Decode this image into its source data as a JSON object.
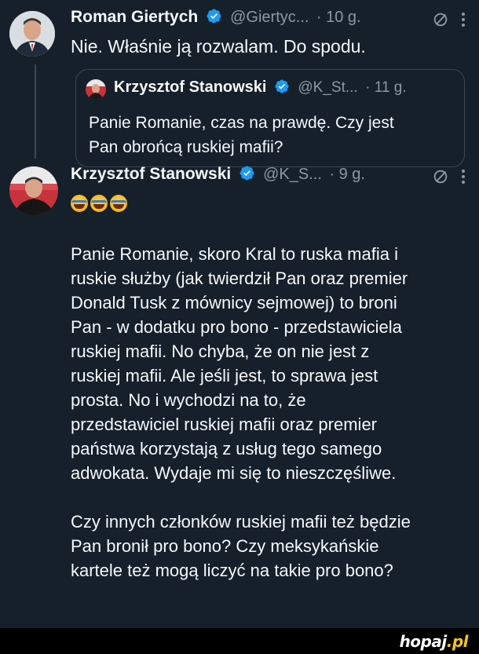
{
  "tweet1": {
    "name": "Roman Giertych",
    "handle": "@Giertyc...",
    "time": "· 10 g.",
    "text": "Nie. Właśnie ją rozwalam. Do spodu."
  },
  "quote": {
    "name": "Krzysztof Stanowski",
    "handle": "@K_St...",
    "time": "· 11 g.",
    "text_line1": "Panie Romanie, czas na prawdę. Czy jest",
    "text_line2": "Pan obrońcą ruskiej mafii?"
  },
  "tweet2": {
    "name": "Krzysztof Stanowski",
    "handle": "@K_S...",
    "time": "· 9 g.",
    "emoji_count": 3,
    "lines": [
      "Panie Romanie, skoro Kral to ruska mafia i",
      "ruskie służby (jak twierdził Pan oraz premier",
      "Donald Tusk z mównicy sejmowej) to broni",
      "Pan - w dodatku pro bono - przedstawiciela",
      "ruskiej mafii. No chyba, że on nie jest z",
      "ruskiej mafii. Ale jeśli jest, to sprawa jest",
      "prosta. No i wychodzi na to, że",
      "przedstawiciel ruskiej mafii oraz premier",
      "państwa korzystają z usług tego samego",
      "adwokata. Wydaje mi się to nieszczęśliwe.",
      "",
      "Czy innych członków ruskiej mafii też będzie",
      "Pan bronił pro bono? Czy meksykańskie",
      "kartele też mogą liczyć na takie pro bono?"
    ]
  },
  "watermark": {
    "main": "hopaj",
    "suffix": ".pl"
  },
  "colors": {
    "background": "#15202b",
    "text": "#f7f9f9",
    "secondary": "#8b98a5",
    "verified": "#1d9bf0",
    "border": "#3b4753"
  },
  "icons": [
    "verified-badge-icon",
    "edit-history-icon",
    "more-options-icon"
  ]
}
